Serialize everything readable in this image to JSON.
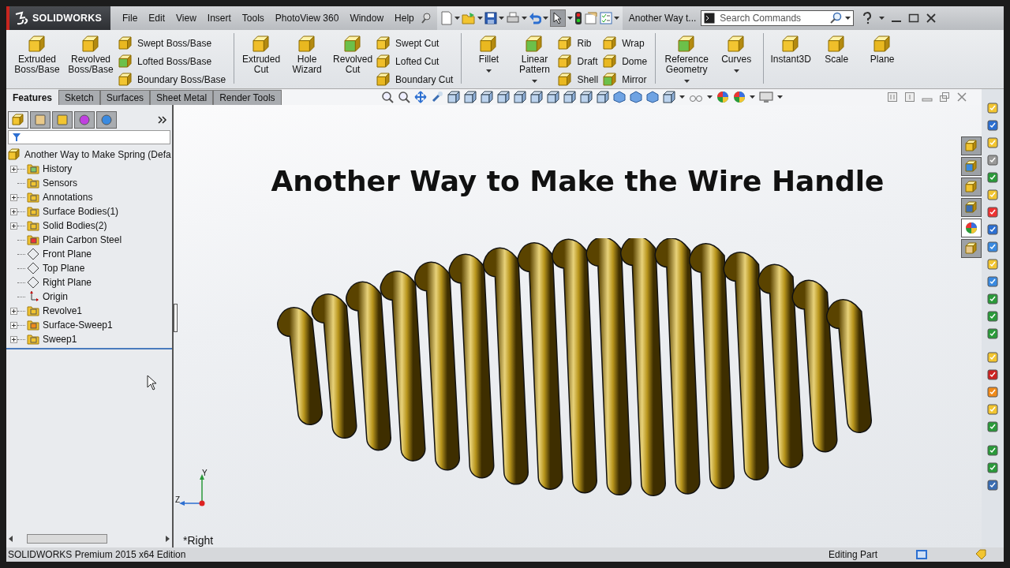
{
  "title_bar": {
    "brand": "SOLIDWORKS",
    "menu": [
      "File",
      "Edit",
      "View",
      "Insert",
      "Tools",
      "PhotoView 360",
      "Window",
      "Help"
    ],
    "document_title": "Another Way t...",
    "search": {
      "placeholder": "Search Commands"
    }
  },
  "ribbon": {
    "groups": [
      {
        "items": [
          {
            "kind": "large",
            "label": "Extruded Boss/Base",
            "dropdown": false
          },
          {
            "kind": "large",
            "label": "Revolved Boss/Base",
            "dropdown": false
          },
          {
            "kind": "stack",
            "items": [
              {
                "label": "Swept Boss/Base"
              },
              {
                "label": "Lofted Boss/Base"
              },
              {
                "label": "Boundary Boss/Base"
              }
            ]
          }
        ]
      },
      {
        "items": [
          {
            "kind": "large",
            "label": "Extruded Cut",
            "dropdown": false
          },
          {
            "kind": "large",
            "label": "Hole Wizard",
            "dropdown": false
          },
          {
            "kind": "large",
            "label": "Revolved Cut",
            "dropdown": false
          },
          {
            "kind": "stack",
            "items": [
              {
                "label": "Swept Cut"
              },
              {
                "label": "Lofted Cut"
              },
              {
                "label": "Boundary Cut"
              }
            ]
          }
        ]
      },
      {
        "items": [
          {
            "kind": "large",
            "label": "Fillet",
            "dropdown": true
          },
          {
            "kind": "large",
            "label": "Linear Pattern",
            "dropdown": true
          },
          {
            "kind": "stack",
            "items": [
              {
                "label": "Rib"
              },
              {
                "label": "Draft"
              },
              {
                "label": "Shell"
              }
            ]
          },
          {
            "kind": "stack",
            "items": [
              {
                "label": "Wrap"
              },
              {
                "label": "Dome"
              },
              {
                "label": "Mirror"
              }
            ]
          }
        ]
      },
      {
        "items": [
          {
            "kind": "large",
            "label": "Reference Geometry",
            "dropdown": true
          },
          {
            "kind": "large",
            "label": "Curves",
            "dropdown": true
          }
        ]
      },
      {
        "items": [
          {
            "kind": "large",
            "label": "Instant3D",
            "dropdown": false
          },
          {
            "kind": "large",
            "label": "Scale",
            "dropdown": false
          },
          {
            "kind": "large",
            "label": "Plane",
            "dropdown": false
          }
        ]
      }
    ]
  },
  "command_tabs": [
    {
      "label": "Features",
      "selected": true
    },
    {
      "label": "Sketch",
      "selected": false
    },
    {
      "label": "Surfaces",
      "selected": false
    },
    {
      "label": "Sheet Metal",
      "selected": false
    },
    {
      "label": "Render Tools",
      "selected": false
    }
  ],
  "feature_tree": {
    "root": "Another Way to Make Spring  (Defa",
    "items": [
      {
        "label": "History",
        "expandable": true
      },
      {
        "label": "Sensors",
        "expandable": false
      },
      {
        "label": "Annotations",
        "expandable": true
      },
      {
        "label": "Surface Bodies(1)",
        "expandable": true
      },
      {
        "label": "Solid Bodies(2)",
        "expandable": true
      },
      {
        "label": "Plain Carbon Steel",
        "expandable": false
      },
      {
        "label": "Front Plane",
        "expandable": false
      },
      {
        "label": "Top Plane",
        "expandable": false
      },
      {
        "label": "Right Plane",
        "expandable": false
      },
      {
        "label": "Origin",
        "expandable": false
      },
      {
        "label": "Revolve1",
        "expandable": true
      },
      {
        "label": "Surface-Sweep1",
        "expandable": true
      },
      {
        "label": "Sweep1",
        "expandable": true
      }
    ]
  },
  "viewport": {
    "title": "Another Way to Make the Wire Handle",
    "view_label": "*Right",
    "triad": {
      "y": "Y",
      "z": "Z"
    }
  },
  "task_pane_tabs": [
    {
      "selected": false
    },
    {
      "selected": false
    },
    {
      "selected": false
    },
    {
      "selected": false
    },
    {
      "selected": true
    },
    {
      "selected": false
    }
  ],
  "status_bar": {
    "edition": "SOLIDWORKS Premium 2015 x64 Edition",
    "mode": "Editing Part"
  }
}
